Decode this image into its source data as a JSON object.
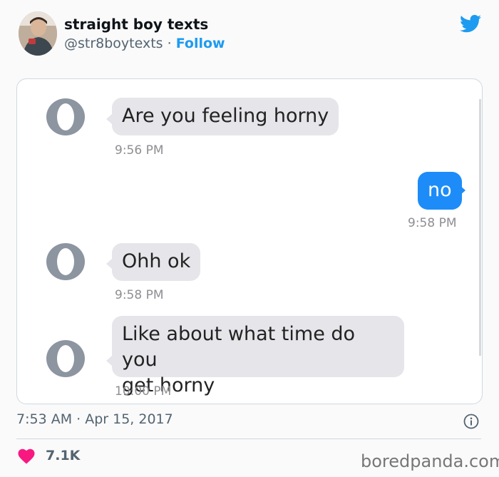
{
  "tweet": {
    "display_name": "straight boy texts",
    "handle": "@str8boytexts",
    "separator": " · ",
    "follow_label": "Follow",
    "timestamp": "7:53 AM · Apr 15, 2017",
    "likes": "7.1K"
  },
  "conversation": [
    {
      "from": "them",
      "text": "Are you feeling horny",
      "time": "9:56 PM"
    },
    {
      "from": "me",
      "text": "no",
      "time": "9:58 PM"
    },
    {
      "from": "them",
      "text": "Ohh ok",
      "time": "9:58 PM"
    },
    {
      "from": "them",
      "text_lines": [
        "Like about what time do you",
        "get horny"
      ],
      "time": "10:00 PM"
    }
  ],
  "watermark": "boredpanda.com",
  "colors": {
    "twitter_blue": "#1d9bf0",
    "sent_bubble": "#1d8cf8",
    "received_bubble": "#e5e5ea",
    "heart": "#f91880",
    "contact_icon": "#8c95a0"
  },
  "icons": [
    "twitter-bird-icon",
    "contact-icon",
    "info-icon",
    "heart-icon"
  ]
}
